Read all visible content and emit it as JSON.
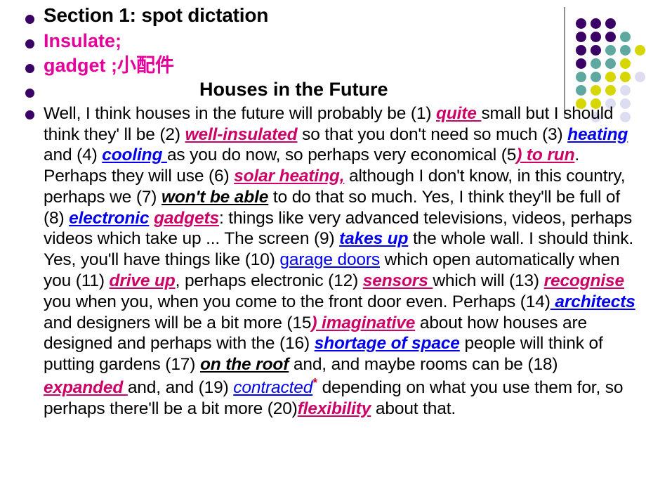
{
  "slide": {
    "section_title": "Section 1: spot dictation",
    "vocab_1": "Insulate;",
    "vocab_2": "gadget  ;小配件",
    "passage_heading": "Houses in the Future",
    "passage": {
      "segments": [
        {
          "text": "Well, I think houses in the future will probably be (1) ",
          "style": "normal"
        },
        {
          "text": "quite ",
          "style": "crimson-answer"
        },
        {
          "text": "small but I should think they' ll be (2) ",
          "style": "normal"
        },
        {
          "text": "well-insulated",
          "style": "crimson-answer"
        },
        {
          "text": " so that you don't need so much (3) ",
          "style": "normal"
        },
        {
          "text": "heating ",
          "style": "blue-answer"
        },
        {
          "text": "and (4) ",
          "style": "normal"
        },
        {
          "text": "cooling ",
          "style": "blue-answer"
        },
        {
          "text": "as you do now, so perhaps very economical (5",
          "style": "normal"
        },
        {
          "text": ") to run",
          "style": "crimson-answer"
        },
        {
          "text": ". Perhaps they will use (6) ",
          "style": "normal"
        },
        {
          "text": "solar heating,",
          "style": "crimson-answer"
        },
        {
          "text": " although I don't know, in this country, perhaps we (7) ",
          "style": "normal"
        },
        {
          "text": "won't be able",
          "style": "black-answer"
        },
        {
          "text": " to do that so much. Yes, I think they'll be full of (8) ",
          "style": "normal"
        },
        {
          "text": "electronic gadgets",
          "style": "blue-crimson-answer"
        },
        {
          "text": ": things like very advanced televisions, videos, perhaps videos which take up ... The screen (9) ",
          "style": "normal"
        },
        {
          "text": "takes up",
          "style": "blue-answer"
        },
        {
          "text": " the whole wall. I should think. Yes, you'll have things like (10) ",
          "style": "normal"
        },
        {
          "text": "garage doors",
          "style": "blue-plain"
        },
        {
          "text": " which open automatically when you (11) ",
          "style": "normal"
        },
        {
          "text": "drive up",
          "style": "crimson-answer"
        },
        {
          "text": ", perhaps electronic (12) ",
          "style": "normal"
        },
        {
          "text": "sensors ",
          "style": "crimson-answer"
        },
        {
          "text": "which will (13) ",
          "style": "normal"
        },
        {
          "text": "recognise ",
          "style": "crimson-answer"
        },
        {
          "text": "you when you, when you come to the front door even. Perhaps (14)",
          "style": "normal"
        },
        {
          "text": " architects",
          "style": "blue-answer"
        },
        {
          "text": " and designers will be a bit more (15",
          "style": "normal"
        },
        {
          "text": ") imaginative",
          "style": "crimson-answer"
        },
        {
          "text": " about how houses are designed and perhaps with the (16) ",
          "style": "normal"
        },
        {
          "text": "shortage of space",
          "style": "blue-answer"
        },
        {
          "text": " people will think of putting gardens (17) ",
          "style": "normal"
        },
        {
          "text": "on the roof",
          "style": "black-answer"
        },
        {
          "text": " and, and maybe rooms can be (18) ",
          "style": "normal"
        },
        {
          "text": "expanded ",
          "style": "crimson-answer"
        },
        {
          "text": "and, and (19) ",
          "style": "normal"
        },
        {
          "text": "contracted",
          "style": "blue-italic-plain"
        },
        {
          "text": "*",
          "style": "asterisk"
        },
        {
          "text": " depending on what you use them for, so perhaps there'll be a bit more (20)",
          "style": "normal"
        },
        {
          "text": "flexibility",
          "style": "crimson-answer"
        },
        {
          "text": " about that.",
          "style": "normal"
        }
      ]
    },
    "answers": [
      {
        "number": 1,
        "word": "quite",
        "color": "#cc0066"
      },
      {
        "number": 2,
        "word": "well-insulated",
        "color": "#cc0066"
      },
      {
        "number": 3,
        "word": "heating",
        "color": "#0000ee"
      },
      {
        "number": 4,
        "word": "cooling",
        "color": "#0000ee"
      },
      {
        "number": 5,
        "word": "to run",
        "color": "#cc0066"
      },
      {
        "number": 6,
        "word": "solar heating",
        "color": "#cc0066"
      },
      {
        "number": 7,
        "word": "won't be able",
        "color": "#000000"
      },
      {
        "number": 8,
        "word": "electronic gadgets",
        "color": "#0000ee"
      },
      {
        "number": 9,
        "word": "takes up",
        "color": "#0000ee"
      },
      {
        "number": 10,
        "word": "garage doors",
        "color": "#0000ee"
      },
      {
        "number": 11,
        "word": "drive up",
        "color": "#cc0066"
      },
      {
        "number": 12,
        "word": "sensors",
        "color": "#cc0066"
      },
      {
        "number": 13,
        "word": "recognise",
        "color": "#cc0066"
      },
      {
        "number": 14,
        "word": "architects",
        "color": "#0000ee"
      },
      {
        "number": 15,
        "word": "imaginative",
        "color": "#cc0066"
      },
      {
        "number": 16,
        "word": "shortage of space",
        "color": "#0000ee"
      },
      {
        "number": 17,
        "word": "on the roof",
        "color": "#000000"
      },
      {
        "number": 18,
        "word": "expanded",
        "color": "#cc0066"
      },
      {
        "number": 19,
        "word": "contracted",
        "color": "#0000ee"
      },
      {
        "number": 20,
        "word": "flexibility",
        "color": "#cc0066"
      }
    ]
  },
  "theme": {
    "bullet_color": "#3b0066",
    "magenta": "#e3009b",
    "crimson": "#cc0066",
    "blue": "#0000ee",
    "deco_purple": "#3b0066",
    "deco_teal": "#5fa8a0",
    "deco_yellow": "#d6d600",
    "deco_lavender": "#ddddf2",
    "deco_line": "#8f8f8f"
  },
  "decoration": {
    "name": "dot-grid-graphic",
    "cols": 5,
    "rows": 8,
    "grid": [
      [
        "purple",
        "purple",
        "purple",
        "none",
        "none"
      ],
      [
        "purple",
        "purple",
        "purple",
        "teal",
        "none"
      ],
      [
        "purple",
        "purple",
        "teal",
        "teal",
        "yellow"
      ],
      [
        "purple",
        "teal",
        "teal",
        "yellow",
        "none"
      ],
      [
        "teal",
        "teal",
        "yellow",
        "yellow",
        "lavender"
      ],
      [
        "teal",
        "yellow",
        "yellow",
        "lavender",
        "none"
      ],
      [
        "yellow",
        "yellow",
        "lavender",
        "lavender",
        "none"
      ],
      [
        "none",
        "lavender",
        "none",
        "lavender",
        "none"
      ]
    ]
  }
}
